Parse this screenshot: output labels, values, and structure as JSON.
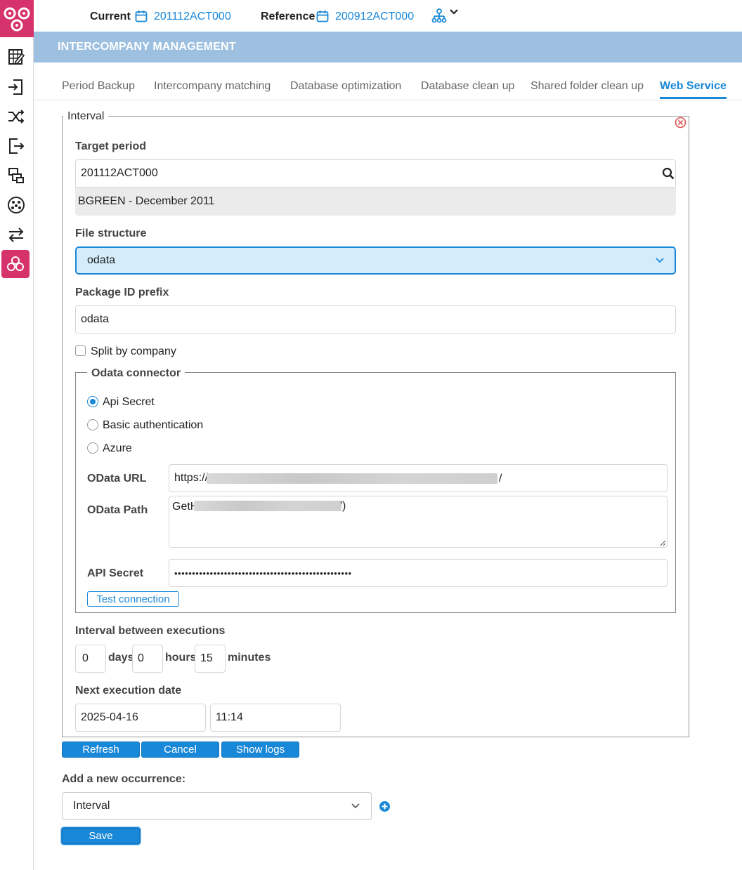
{
  "header": {
    "current_label": "Current",
    "current_value": "201112ACT000",
    "reference_label": "Reference",
    "reference_value": "200912ACT000"
  },
  "banner": {
    "title": "INTERCOMPANY MANAGEMENT"
  },
  "tabs": [
    {
      "label": "Period Backup"
    },
    {
      "label": "Intercompany matching"
    },
    {
      "label": "Database optimization"
    },
    {
      "label": "Database clean up"
    },
    {
      "label": "Shared folder clean up"
    },
    {
      "label": "Web Service",
      "active": true
    }
  ],
  "interval_form": {
    "legend": "Interval",
    "target_period": {
      "label": "Target period",
      "value": "201112ACT000",
      "description": "BGREEN - December 2011"
    },
    "file_structure": {
      "label": "File structure",
      "value": "odata"
    },
    "package_id_prefix": {
      "label": "Package ID prefix",
      "value": "odata"
    },
    "split_by_company": {
      "label": "Split by company",
      "checked": false
    },
    "odata_connector": {
      "legend": "Odata connector",
      "auth_options": [
        {
          "label": "Api Secret",
          "selected": true
        },
        {
          "label": "Basic authentication",
          "selected": false
        },
        {
          "label": "Azure",
          "selected": false
        }
      ],
      "odata_url": {
        "label": "OData URL",
        "prefix": "https://",
        "suffix": "/"
      },
      "odata_path": {
        "label": "OData Path",
        "prefix": "GetH",
        "suffix": "')"
      },
      "api_secret": {
        "label": "API Secret",
        "masked_value": "••••••••••••••••••••••••••••••••••••••••••••••••••"
      },
      "test_button": "Test connection"
    },
    "interval_between": {
      "label": "Interval between executions",
      "days_value": "0",
      "days_label": "days",
      "hours_value": "0",
      "hours_label": "hours",
      "minutes_value": "15",
      "minutes_label": "minutes"
    },
    "next_execution": {
      "label": "Next execution date",
      "date": "2025-04-16",
      "time": "11:14"
    }
  },
  "actions": {
    "refresh": "Refresh",
    "cancel": "Cancel",
    "show_logs": "Show logs"
  },
  "new_occurrence": {
    "label": "Add a new occurrence:",
    "value": "Interval",
    "save": "Save"
  },
  "colors": {
    "brand": "#d6336c",
    "accent": "#1a88d8",
    "banner": "#9dbfe0",
    "close": "#e05050"
  }
}
